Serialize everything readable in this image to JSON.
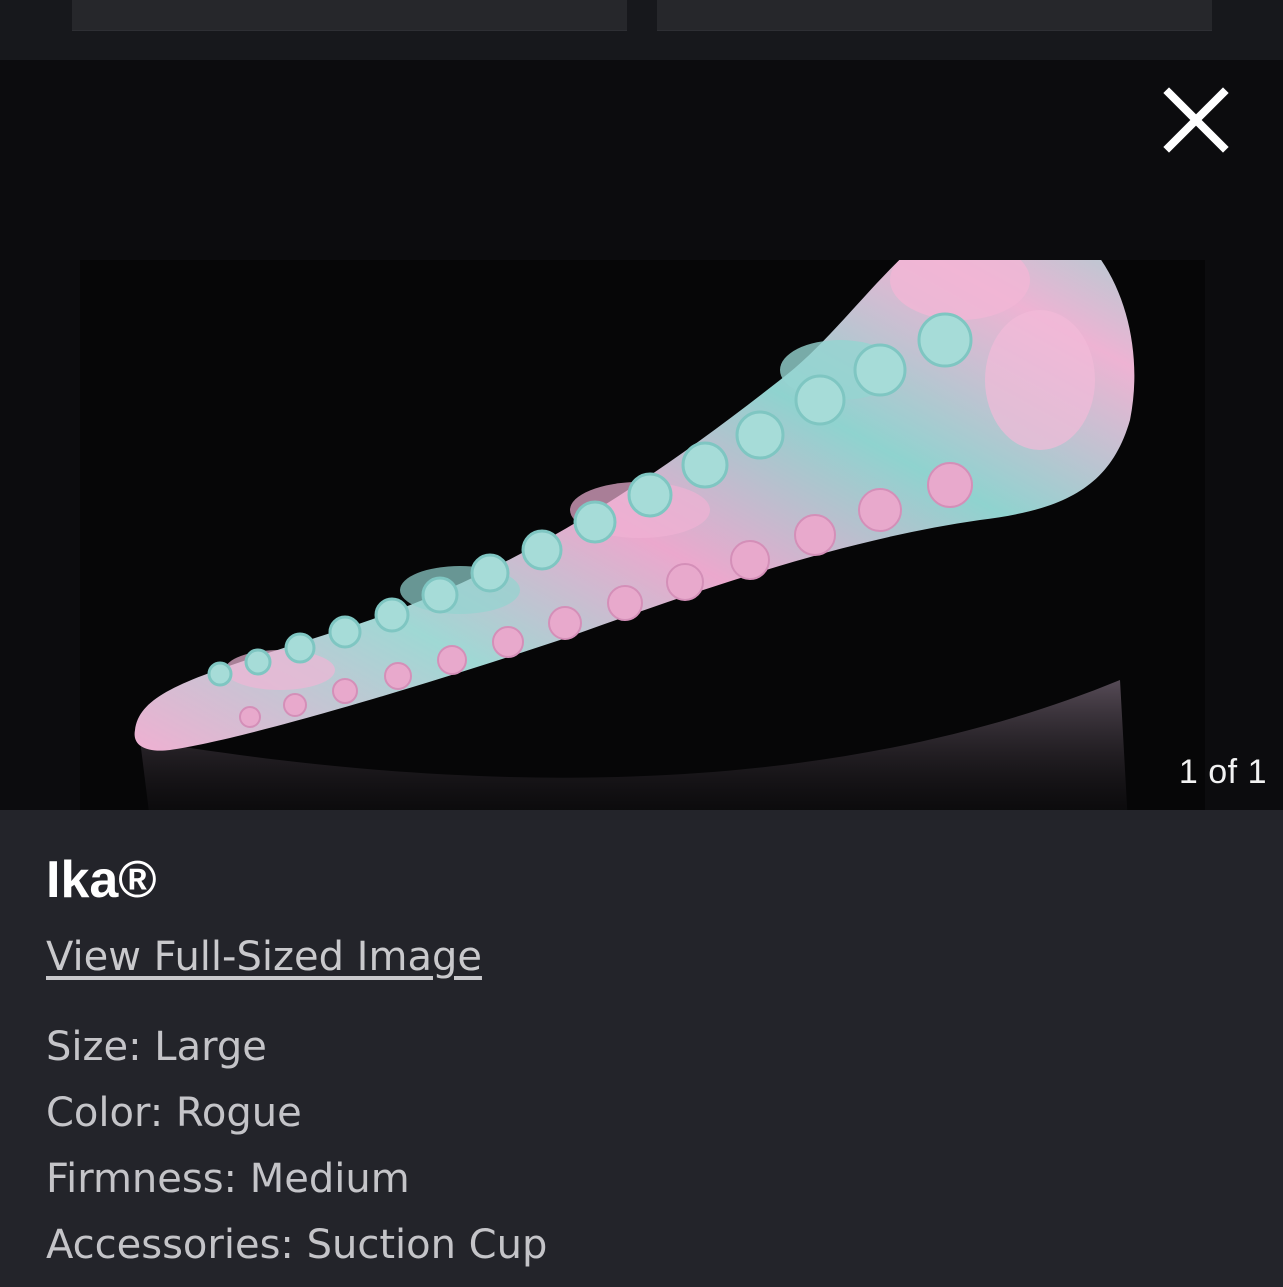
{
  "lightbox": {
    "counter": "1 of 1",
    "close_icon": "close-icon"
  },
  "product": {
    "title": "Ika®",
    "view_full_link": "View Full-Sized Image",
    "attributes": [
      "Size: Large",
      "Color: Rogue",
      "Firmness: Medium",
      "Accessories: Suction Cup"
    ]
  },
  "colors": {
    "pink": "#e9a6cc",
    "teal": "#8fd3cf",
    "panel_bg": "#23242a",
    "viewer_bg": "#0c0c0e"
  }
}
